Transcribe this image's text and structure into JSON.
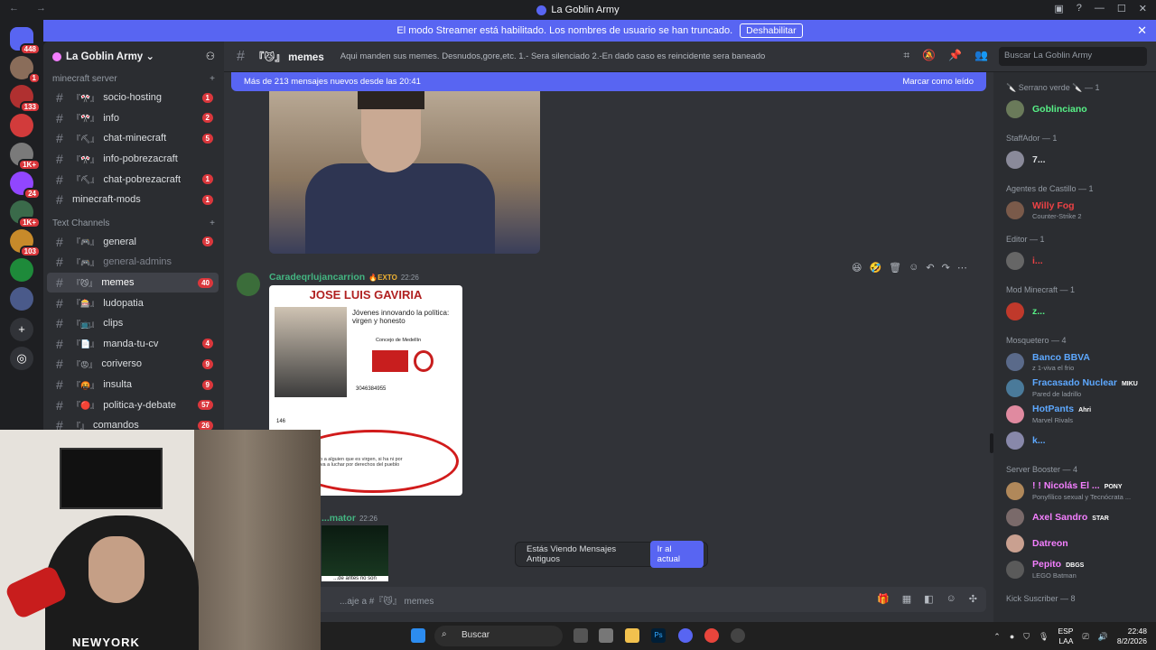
{
  "window": {
    "title": "La Goblin Army"
  },
  "banner": {
    "text": "El modo Streamer está habilitado. Los nombres de usuario se han truncado.",
    "button": "Deshabilitar"
  },
  "guilds": [
    {
      "badge": "448",
      "color": "#5865f2"
    },
    {
      "badge": "1",
      "color": "#8a6d5a"
    },
    {
      "badge": "133",
      "color": "#b03030"
    },
    {
      "badge": "",
      "color": "#d23b3b"
    },
    {
      "badge": "1K+",
      "color": "#7a7a7a"
    },
    {
      "badge": "24",
      "color": "#9146ff"
    },
    {
      "badge": "1K+",
      "color": "#3a6a4a"
    },
    {
      "badge": "103",
      "color": "#c78a2a"
    },
    {
      "badge": "",
      "color": "#1e8a3a"
    },
    {
      "badge": "",
      "color": "#4a5a8a"
    }
  ],
  "sidebar": {
    "server_name": "La Goblin Army",
    "category1": "minecraft server",
    "category2": "Text Channels",
    "channels1": [
      {
        "emoji": "『🎌』",
        "name": "socio-hosting",
        "count": "1"
      },
      {
        "emoji": "『🎌』",
        "name": "info",
        "count": "2"
      },
      {
        "emoji": "『⛏』",
        "name": "chat-minecraft",
        "count": "5"
      },
      {
        "emoji": "『🎌』",
        "name": "info-pobrezacraft",
        "count": ""
      },
      {
        "emoji": "『⛏』",
        "name": "chat-pobrezacraft",
        "count": "1"
      },
      {
        "emoji": "",
        "name": "minecraft-mods",
        "count": "1"
      }
    ],
    "channels2": [
      {
        "emoji": "『🎮』",
        "name": "general",
        "count": "5"
      },
      {
        "emoji": "『🎮』",
        "name": "general-admins",
        "count": ""
      },
      {
        "emoji": "『😼』",
        "name": "memes",
        "count": "40"
      },
      {
        "emoji": "『🎰』",
        "name": "ludopatia",
        "count": ""
      },
      {
        "emoji": "『📺』",
        "name": "clips",
        "count": ""
      },
      {
        "emoji": "『📄』",
        "name": "manda-tu-cv",
        "count": "4"
      },
      {
        "emoji": "『😡』",
        "name": "coriverso",
        "count": "9"
      },
      {
        "emoji": "『🤬』",
        "name": "insulta",
        "count": "9"
      },
      {
        "emoji": "『🔴』",
        "name": "politica-y-debate",
        "count": "57"
      },
      {
        "emoji": "『』",
        "name": "comandos",
        "count": "26"
      }
    ]
  },
  "channel": {
    "name": "『😼』 memes",
    "topic": "Aqui manden sus memes. Desnudos,gore,etc. 1.- Sera silenciado 2.-En dado caso es reincidente sera baneado",
    "search_placeholder": "Buscar La Goblin Army"
  },
  "newbar": {
    "text": "Más de 213 mensajes nuevos desde las 20:41",
    "action": "Marcar como leído"
  },
  "message1": {
    "author": "Caradeqrlujancarrion",
    "tag": "🔥EXTO",
    "time": "22:26"
  },
  "meme": {
    "headline": "JOSE LUIS GAVIRIA",
    "line1": "Jóvenes innovando la política:",
    "line2": "virgen y honesto",
    "org": "Concejo de Medellín",
    "phone": "3046384955",
    "reactions": "146",
    "comment": "Puedo confiar mi voto a alguien que es virgen, si ha ni por culiar mucho menos va a luchar por derechos del pueblo"
  },
  "message2": {
    "author": "...mator",
    "time": "22:26",
    "caption": "...de antes no son"
  },
  "jump": {
    "text": "Estás Viendo Mensajes Antiguos",
    "button": "Ir al actual"
  },
  "composer": {
    "placeholder": "...aje a #『😼』 memes"
  },
  "members": [
    {
      "category": "🔪 Serrano verde 🔪 — 1",
      "items": [
        {
          "name": "Goblinciano",
          "status": "",
          "color": "#57f287",
          "pill": ""
        }
      ]
    },
    {
      "category": "StaffAdor — 1",
      "items": [
        {
          "name": "7...",
          "status": "",
          "color": "#dbdee1",
          "pill": ""
        }
      ]
    },
    {
      "category": "Agentes de Castillo — 1",
      "items": [
        {
          "name": "Willy Fog",
          "status": "Counter-Strike 2",
          "color": "#ed4245",
          "pill": ""
        }
      ]
    },
    {
      "category": "Editor — 1",
      "items": [
        {
          "name": "i...",
          "status": "",
          "color": "#ed4245",
          "pill": ""
        }
      ]
    },
    {
      "category": "Mod Minecraft — 1",
      "items": [
        {
          "name": "z...",
          "status": "",
          "color": "#57f287",
          "pill": ""
        }
      ]
    },
    {
      "category": "Mosquetero — 4",
      "items": [
        {
          "name": "Banco BBVA",
          "status": "z 1-viva el frio",
          "color": "#5da8ff",
          "pill": ""
        },
        {
          "name": "Fracasado Nuclear",
          "status": "Pared de ladrillo",
          "color": "#5da8ff",
          "pill": "MIKU"
        },
        {
          "name": "HotPants",
          "status": "Marvel Rivals",
          "color": "#5da8ff",
          "pill": "Ahri"
        },
        {
          "name": "k...",
          "status": "",
          "color": "#5da8ff",
          "pill": ""
        }
      ]
    },
    {
      "category": "Server Booster — 4",
      "items": [
        {
          "name": "! ! Nicolás El ...",
          "status": "Ponyfílico sexual y Tecnócrata ...",
          "color": "#f47fff",
          "pill": "PONY"
        },
        {
          "name": "Axel Sandro",
          "status": "",
          "color": "#f47fff",
          "pill": "STAR"
        },
        {
          "name": "Datreon",
          "status": "",
          "color": "#f47fff",
          "pill": ""
        },
        {
          "name": "Pepito",
          "status": "LEGO Batman",
          "color": "#f47fff",
          "pill": "DBGS"
        }
      ]
    },
    {
      "category": "Kick Suscriber — 8",
      "items": []
    }
  ],
  "taskbar": {
    "search": "Buscar",
    "lang1": "ESP",
    "lang2": "LAA",
    "time": "22:48",
    "date": "8/2/2026"
  }
}
